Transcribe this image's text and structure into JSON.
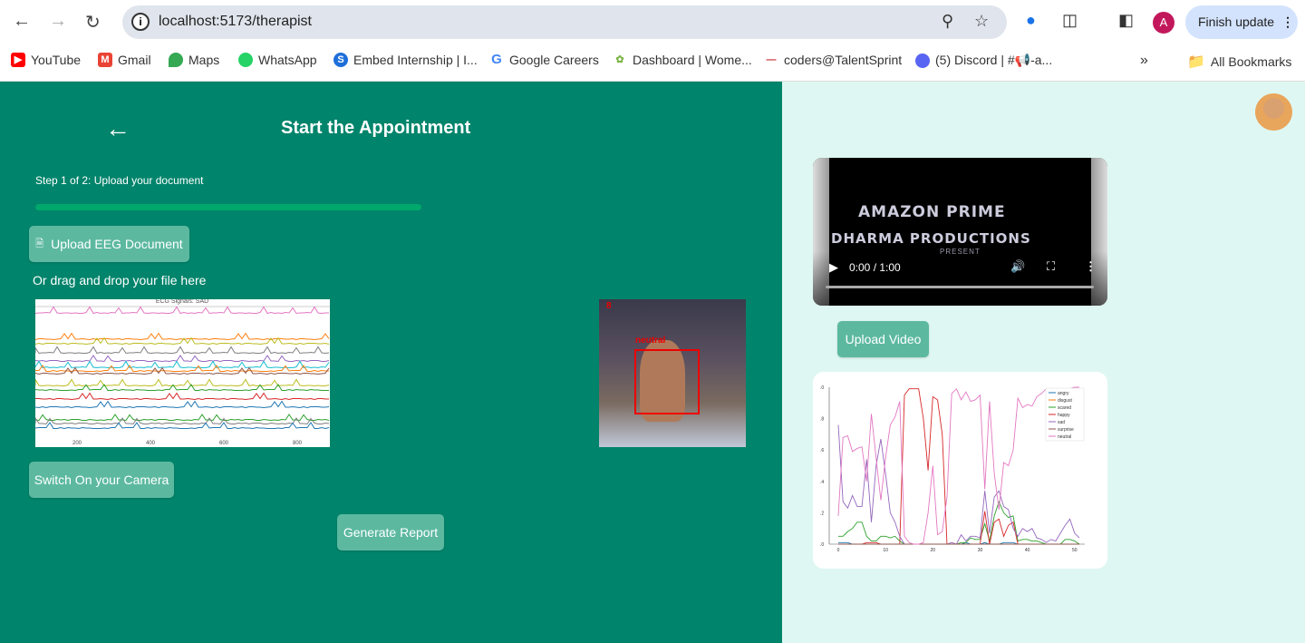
{
  "browser": {
    "url": "localhost:5173/therapist",
    "finish_update_label": "Finish update",
    "profile_initial": "A",
    "bookmarks": [
      {
        "label": "YouTube",
        "icon": "youtube-icon",
        "color": "#ff0000"
      },
      {
        "label": "Gmail",
        "icon": "gmail-icon",
        "color": "#ea4335"
      },
      {
        "label": "Maps",
        "icon": "maps-icon",
        "color": "#34a853"
      },
      {
        "label": "WhatsApp",
        "icon": "whatsapp-icon",
        "color": "#25d366"
      },
      {
        "label": "Embed Internship | I...",
        "icon": "embed-icon",
        "color": "#1e6fd9"
      },
      {
        "label": "Google Careers",
        "icon": "google-icon",
        "color": "#4285f4"
      },
      {
        "label": "Dashboard | Wome...",
        "icon": "dashboard-icon",
        "color": "#7cb342"
      },
      {
        "label": "coders@TalentSprint",
        "icon": "talentsprint-icon",
        "color": "#c62828"
      },
      {
        "label": "(5) Discord | #📢-a...",
        "icon": "discord-icon",
        "color": "#5865f2"
      }
    ],
    "all_bookmarks_label": "All Bookmarks"
  },
  "page": {
    "title": "Start the Appointment",
    "step_text": "Step 1 of 2: Upload your document",
    "progress_percent": 100,
    "upload_eeg_label": "Upload EEG Document",
    "drag_text": "Or drag and drop your file here",
    "camera_label": "Switch On your Camera",
    "generate_label": "Generate Report",
    "eeg_plot": {
      "title": "ECG Signals: SAD",
      "x_ticks": [
        "200",
        "400",
        "600",
        "800"
      ]
    },
    "camera": {
      "emotion_label": "neutral",
      "frame_counter": "8"
    },
    "video": {
      "line1": "AMAZON PRIME",
      "line2": "DHARMA PRODUCTIONS",
      "line3": "PRESENT",
      "time": "0:00 / 1:00"
    },
    "upload_video_label": "Upload Video"
  },
  "chart_data": {
    "type": "line",
    "x_ticks": [
      "0",
      "10",
      "20",
      "30",
      "40",
      "50"
    ],
    "y_ticks": [
      ".0",
      ".2",
      ".4",
      ".6",
      ".8",
      ".0"
    ],
    "ylim": [
      0,
      1
    ],
    "xlim": [
      0,
      51
    ],
    "legend_position": "top-right",
    "series": [
      {
        "name": "angry",
        "color": "#1f77b4",
        "values": [
          0.01,
          0.01,
          0.01,
          0,
          0,
          0,
          0,
          0,
          0,
          0,
          0,
          0,
          0,
          0,
          0,
          0,
          0,
          0,
          0,
          0,
          0,
          0,
          0,
          0,
          0,
          0,
          0,
          0.01,
          0,
          0,
          0,
          0.01,
          0,
          0,
          0,
          0.01,
          0.01,
          0.01,
          0,
          0,
          0,
          0,
          0,
          0,
          0,
          0,
          0,
          0,
          0,
          0,
          0,
          0
        ]
      },
      {
        "name": "disgust",
        "color": "#ff7f0e",
        "values": [
          0,
          0,
          0,
          0,
          0,
          0,
          0,
          0,
          0,
          0,
          0,
          0,
          0,
          0,
          0,
          0,
          0,
          0,
          0,
          0,
          0,
          0,
          0,
          0,
          0,
          0,
          0,
          0,
          0,
          0,
          0,
          0,
          0,
          0,
          0,
          0,
          0,
          0,
          0,
          0,
          0,
          0,
          0,
          0,
          0,
          0,
          0,
          0,
          0,
          0,
          0,
          0
        ]
      },
      {
        "name": "scared",
        "color": "#2ca02c",
        "values": [
          0.05,
          0.05,
          0.08,
          0.1,
          0.14,
          0.14,
          0.05,
          0.02,
          0.02,
          0.05,
          0.05,
          0.04,
          0.05,
          0.02,
          0,
          0,
          0,
          0,
          0,
          0,
          0,
          0,
          0,
          0,
          0,
          0,
          0.01,
          0.01,
          0.04,
          0.03,
          0.03,
          0.13,
          0.02,
          0.18,
          0.27,
          0.2,
          0.17,
          0.18,
          0.02,
          0.03,
          0.03,
          0.02,
          0.02,
          0.01,
          0,
          0,
          0,
          0,
          0.03,
          0.03,
          0.02,
          0
        ]
      },
      {
        "name": "happy",
        "color": "#d62728",
        "values": [
          0,
          0,
          0,
          0,
          0,
          0,
          0.01,
          0.01,
          0.01,
          0,
          0,
          0,
          0,
          0,
          0.95,
          0.99,
          0.99,
          0.99,
          0.8,
          0.47,
          0.94,
          0.92,
          0.7,
          0,
          0,
          0,
          0,
          0,
          0,
          0,
          0,
          0.21,
          0,
          0.14,
          0.16,
          0.05,
          0.12,
          0.14,
          0,
          0,
          0,
          0,
          0,
          0,
          0,
          0,
          0,
          0,
          0,
          0,
          0,
          0
        ]
      },
      {
        "name": "sad",
        "color": "#9467bd",
        "values": [
          0.76,
          0.27,
          0.23,
          0.31,
          0.24,
          0.24,
          0.54,
          0.14,
          0.5,
          0.67,
          0.45,
          0.2,
          0.14,
          0.05,
          0,
          0,
          0,
          0,
          0,
          0,
          0,
          0,
          0,
          0,
          0.01,
          0,
          0.06,
          0.02,
          0.05,
          0.05,
          0.04,
          0.34,
          0.07,
          0.3,
          0.34,
          0.24,
          0.22,
          0.1,
          0.05,
          0.1,
          0.08,
          0.1,
          0.04,
          0.03,
          0.01,
          0.03,
          0.02,
          0.07,
          0.12,
          0.16,
          0.07,
          0.04
        ]
      },
      {
        "name": "surprise",
        "color": "#8c564b",
        "values": [
          0,
          0,
          0,
          0,
          0,
          0,
          0,
          0,
          0,
          0,
          0,
          0,
          0,
          0,
          0,
          0,
          0,
          0,
          0,
          0,
          0,
          0,
          0,
          0,
          0,
          0,
          0,
          0,
          0,
          0,
          0,
          0,
          0,
          0,
          0,
          0,
          0,
          0,
          0,
          0,
          0,
          0,
          0,
          0,
          0,
          0,
          0,
          0,
          0,
          0,
          0,
          0
        ]
      },
      {
        "name": "neutral",
        "color": "#e377c2",
        "values": [
          0.18,
          0.68,
          0.69,
          0.59,
          0.61,
          0.62,
          0.4,
          0.83,
          0.55,
          0.28,
          0.55,
          0.76,
          0.81,
          0.91,
          0.05,
          0.01,
          0,
          0,
          0.01,
          0.2,
          0.5,
          0.06,
          0.08,
          0.3,
          0.96,
          0.99,
          0.92,
          0.97,
          0.91,
          0.92,
          0.95,
          0.35,
          0.91,
          0.45,
          0.22,
          0.52,
          0.5,
          0.6,
          0.93,
          0.87,
          0.89,
          0.88,
          0.94,
          0.96,
          0.99,
          0.96,
          0.97,
          0.98,
          0.99,
          0.99,
          1.0,
          1.0
        ]
      }
    ]
  },
  "colors": {
    "left_bg": "#00846b",
    "right_bg": "#dff7f2",
    "button": "#5cb9a0",
    "progress": "#00a86b"
  }
}
